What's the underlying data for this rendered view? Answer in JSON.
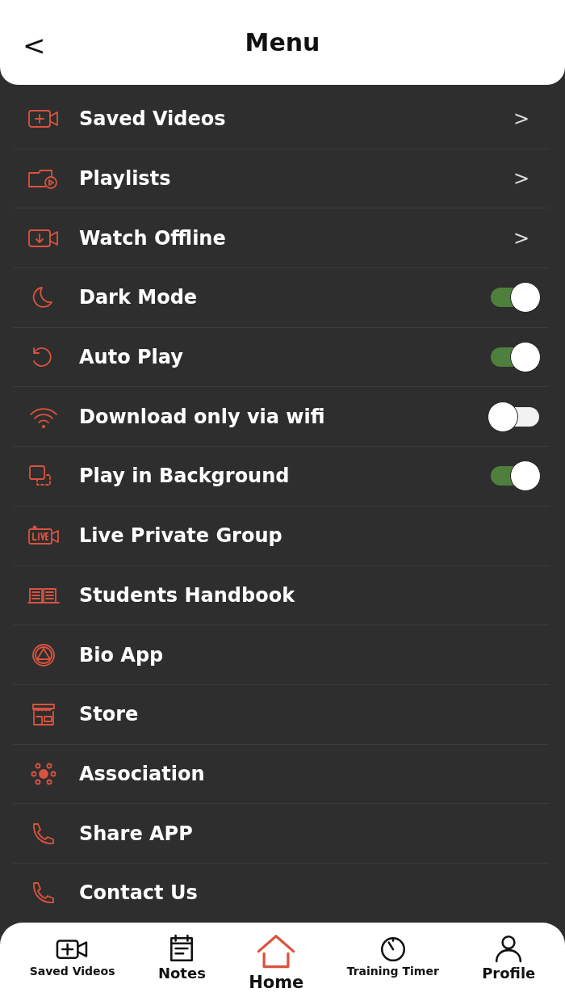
{
  "header": {
    "back": "<",
    "title": "Menu"
  },
  "items": [
    {
      "kind": "link",
      "label": "Saved Videos",
      "chevron": ">"
    },
    {
      "kind": "link",
      "label": "Playlists",
      "chevron": ">"
    },
    {
      "kind": "link",
      "label": "Watch Offline",
      "chevron": ">"
    },
    {
      "kind": "toggle",
      "label": "Dark Mode",
      "on": true
    },
    {
      "kind": "toggle",
      "label": "Auto Play",
      "on": true
    },
    {
      "kind": "toggle",
      "label": "Download only via wifi",
      "on": false
    },
    {
      "kind": "toggle",
      "label": "Play in Background",
      "on": true
    },
    {
      "kind": "plain",
      "label": "Live Private Group"
    },
    {
      "kind": "plain",
      "label": "Students Handbook"
    },
    {
      "kind": "plain",
      "label": "Bio App"
    },
    {
      "kind": "plain",
      "label": "Store"
    },
    {
      "kind": "plain",
      "label": "Association"
    },
    {
      "kind": "plain",
      "label": "Share APP"
    },
    {
      "kind": "plain",
      "label": "Contact Us"
    }
  ],
  "tab_bar": [
    {
      "label": "Saved Videos",
      "selected": false
    },
    {
      "label": "Notes",
      "selected": false
    },
    {
      "label": "Home",
      "selected": true
    },
    {
      "label": "Training Timer",
      "selected": false
    },
    {
      "label": "Profile",
      "selected": false
    }
  ]
}
